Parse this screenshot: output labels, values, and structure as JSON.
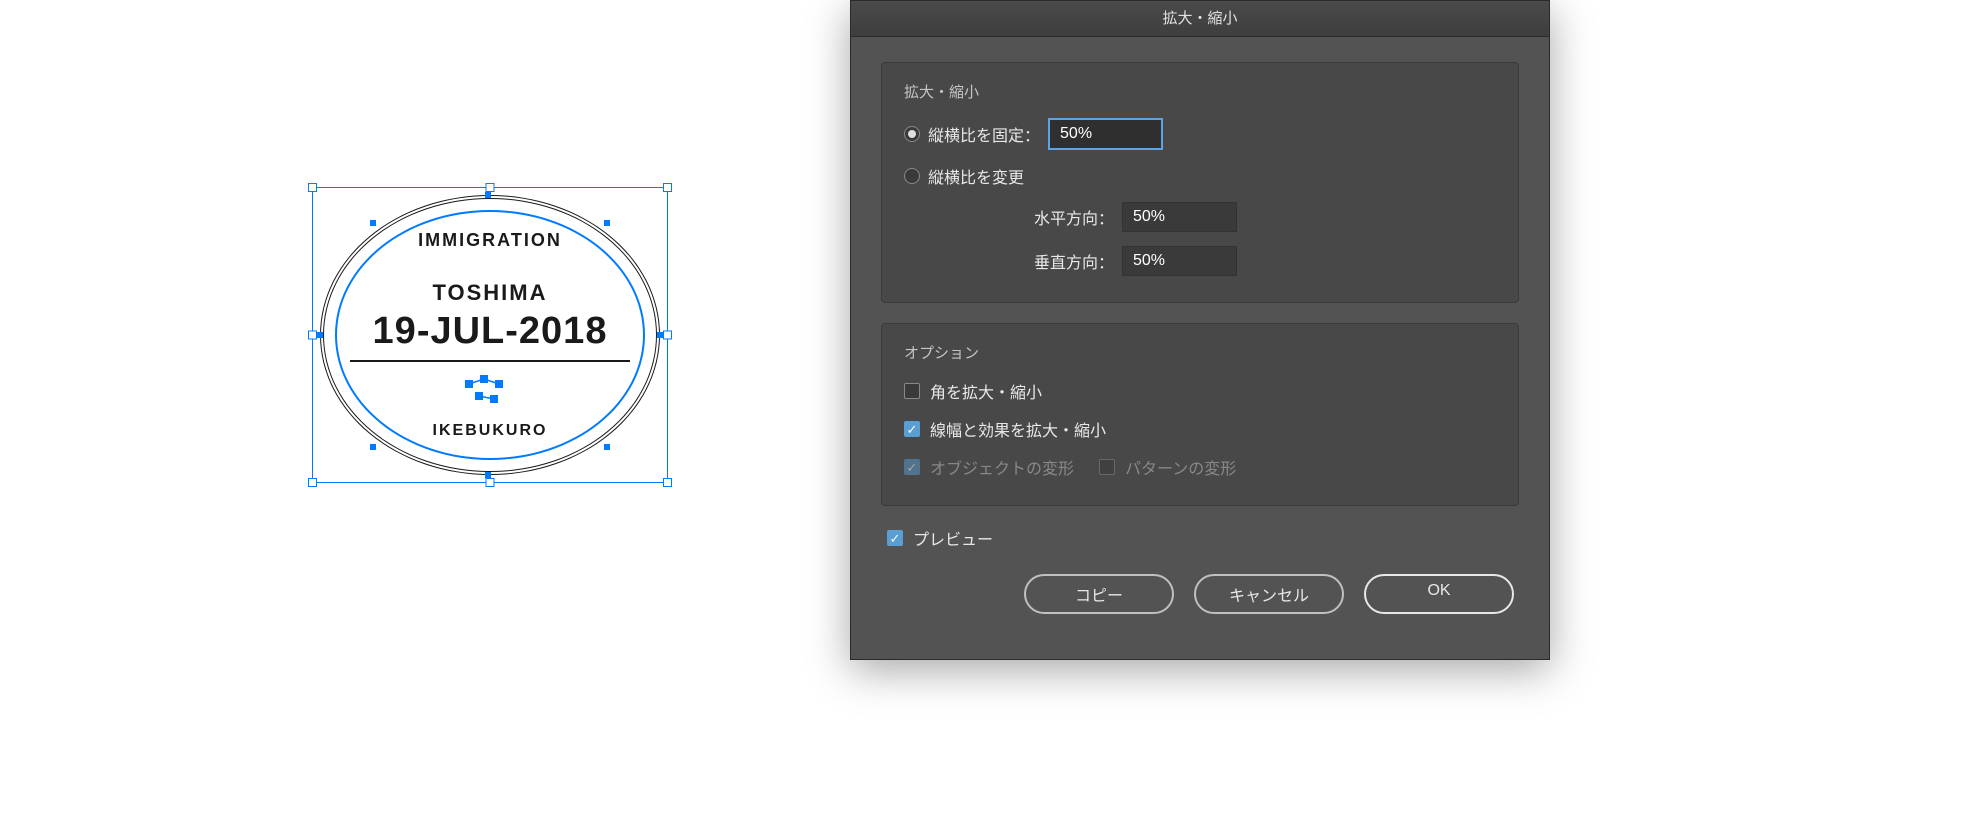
{
  "dialog": {
    "title": "拡大・縮小",
    "scale_section": {
      "title": "拡大・縮小",
      "uniform_label": "縦横比を固定：",
      "uniform_value": "50%",
      "nonuniform_label": "縦横比を変更",
      "horizontal_label": "水平方向：",
      "horizontal_value": "50%",
      "vertical_label": "垂直方向：",
      "vertical_value": "50%"
    },
    "options_section": {
      "title": "オプション",
      "scale_corners": "角を拡大・縮小",
      "scale_strokes": "線幅と効果を拡大・縮小",
      "transform_objects": "オブジェクトの変形",
      "transform_patterns": "パターンの変形"
    },
    "preview_label": "プレビュー",
    "buttons": {
      "copy": "コピー",
      "cancel": "キャンセル",
      "ok": "OK"
    }
  },
  "stamp": {
    "arc_top": "IMMIGRATION",
    "city": "TOSHIMA",
    "date": "19-JUL-2018",
    "arc_bottom": "IKEBUKURO"
  }
}
